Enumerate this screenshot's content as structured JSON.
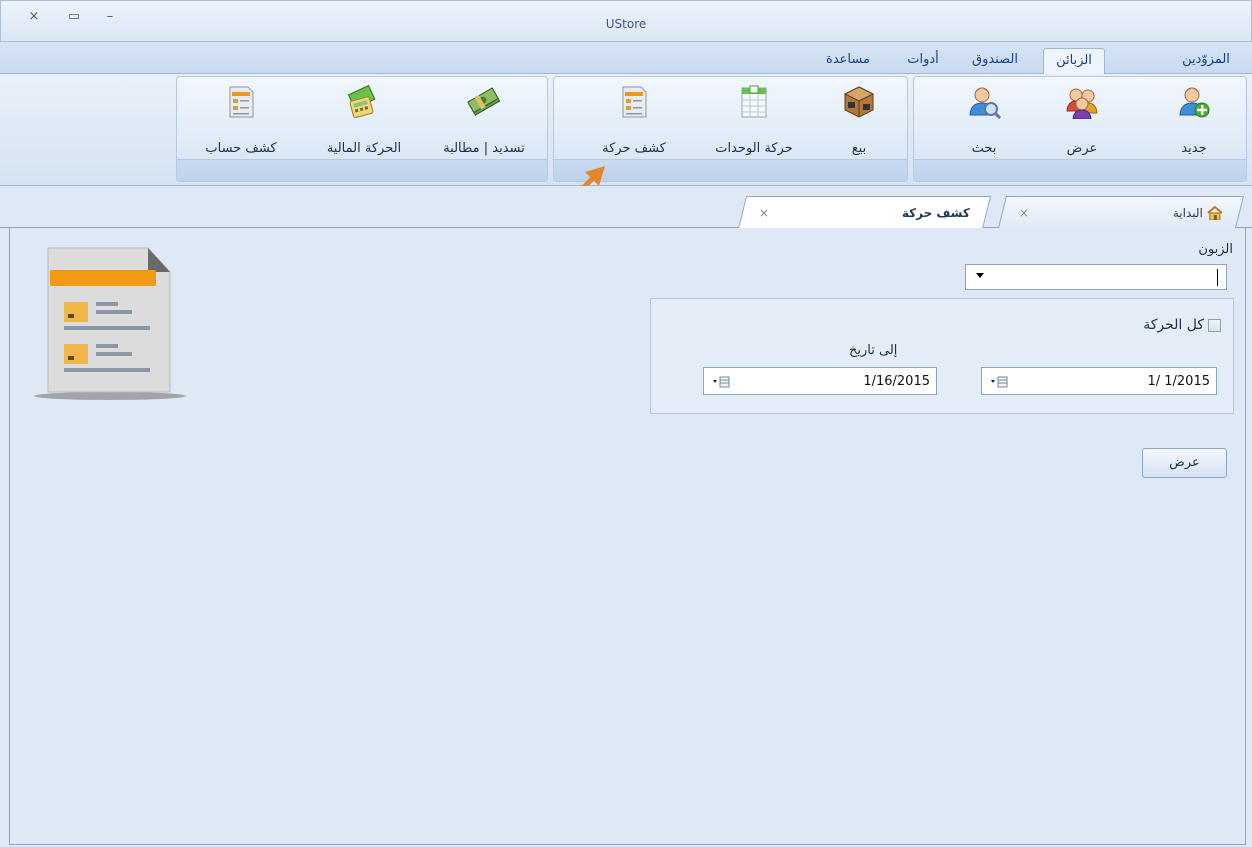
{
  "window": {
    "title": "UStore",
    "close_glyph": "×",
    "restore_glyph": "▭",
    "minimize_glyph": "–"
  },
  "ribbon_tabs": [
    {
      "label": "المزوّدين"
    },
    {
      "label": "الزبائن"
    },
    {
      "label": "الصندوق"
    },
    {
      "label": "أدوات"
    },
    {
      "label": "مساعدة"
    }
  ],
  "ribbon_buttons": {
    "new": "جديد",
    "view": "عرض",
    "search": "بحث",
    "sell": "بيع",
    "units_movement": "حركة الوحدات",
    "movement_statement": "كشف حركة",
    "payment_claim": "تسديد | مطالبة",
    "financial_movement": "الحركة المالية",
    "account_statement": "كشف حساب"
  },
  "doc_tabs": {
    "home_label": "البداية",
    "current_label": "كشف حركة",
    "close_glyph": "×"
  },
  "form": {
    "customer_label": "الزبون",
    "customer_value": "",
    "all_movement_label": "كل الحركة",
    "to_date_label": "إلى تاريخ",
    "from_date": "1/ 1/2015",
    "to_date": "1/16/2015",
    "show_button": "عرض"
  },
  "colors": {
    "accent": "#15428b",
    "arrow": "#e8862a"
  }
}
